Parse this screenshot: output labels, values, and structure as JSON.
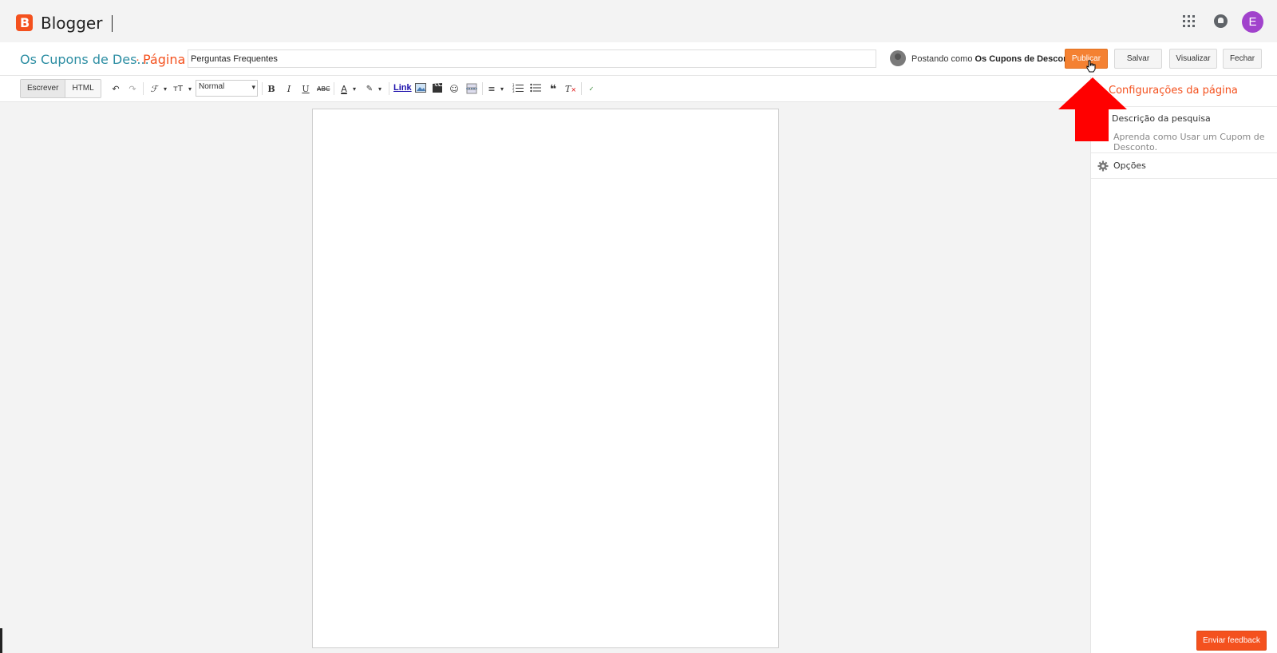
{
  "app": {
    "brand": "Blogger",
    "avatar_letter": "E"
  },
  "header": {
    "blog_name": "Os Cupons de Des...",
    "separator": "·",
    "page_type": "Página",
    "title_value": "Perguntas Frequentes",
    "posting_as_prefix": "Postando como",
    "posting_as_name": "Os Cupons de Desconto",
    "buttons": {
      "publish": "Publicar",
      "save": "Salvar",
      "preview": "Visualizar",
      "close": "Fechar"
    }
  },
  "toolbar": {
    "mode_compose": "Escrever",
    "mode_html": "HTML",
    "format_value": "Normal",
    "link": "Link"
  },
  "sidebar": {
    "title": "Configurações da página",
    "search_description_label": "Descrição da pesquisa",
    "search_description_value": "Aprenda como Usar um Cupom de Desconto.",
    "options_label": "Opções"
  },
  "feedback": {
    "label": "Enviar feedback"
  },
  "colors": {
    "accent": "#f4511e",
    "publish": "#f48132",
    "link": "#2d8ea3",
    "avatar": "#a142cc",
    "annotation_arrow": "#ff0000"
  }
}
